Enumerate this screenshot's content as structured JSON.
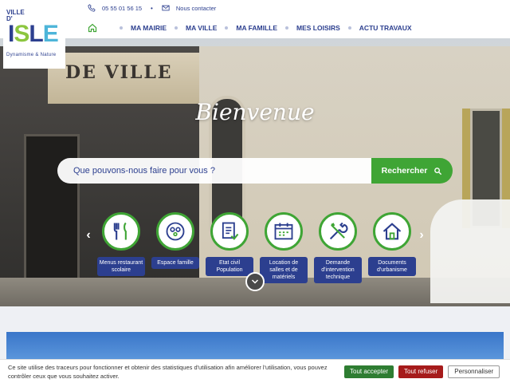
{
  "logo": {
    "top": "VILLE D'",
    "main": [
      "I",
      "S",
      "L",
      "E"
    ],
    "tagline": "Dynamisme & Nature"
  },
  "header": {
    "phone": "05 55 01 56 15",
    "contact": "Nous contacter",
    "separator": "•"
  },
  "nav": {
    "items": [
      "MA MAIRIE",
      "MA VILLE",
      "MA FAMILLE",
      "MES LOISIRS",
      "ACTU TRAVAUX"
    ]
  },
  "hero": {
    "sign_text": "DE VILLE",
    "title": "Bienvenue",
    "search_placeholder": "Que pouvons-nous faire pour vous ?",
    "search_button": "Rechercher"
  },
  "shortcuts": [
    {
      "label": "Menus restaurant scolaire",
      "icon": "utensils-icon"
    },
    {
      "label": "Espace famille",
      "icon": "family-icon"
    },
    {
      "label": "Etat civil Population",
      "icon": "civil-document-icon"
    },
    {
      "label": "Location de salles et de matériels",
      "icon": "calendar-icon"
    },
    {
      "label": "Demande d'intervention technique",
      "icon": "tools-icon"
    },
    {
      "label": "Documents d'urbanisme",
      "icon": "house-plan-icon"
    }
  ],
  "cookie": {
    "text": "Ce site utilise des traceurs pour fonctionner et obtenir des statistiques d'utilisation afin améliorer l'utilisation, vous pouvez contrôler ceux que vous souhaitez activer.",
    "accept": "Tout accepter",
    "refuse": "Tout refuser",
    "customize": "Personnaliser"
  },
  "colors": {
    "brand_blue": "#2c3f8f",
    "brand_green": "#3fa535",
    "refuse_red": "#a61b1b"
  }
}
